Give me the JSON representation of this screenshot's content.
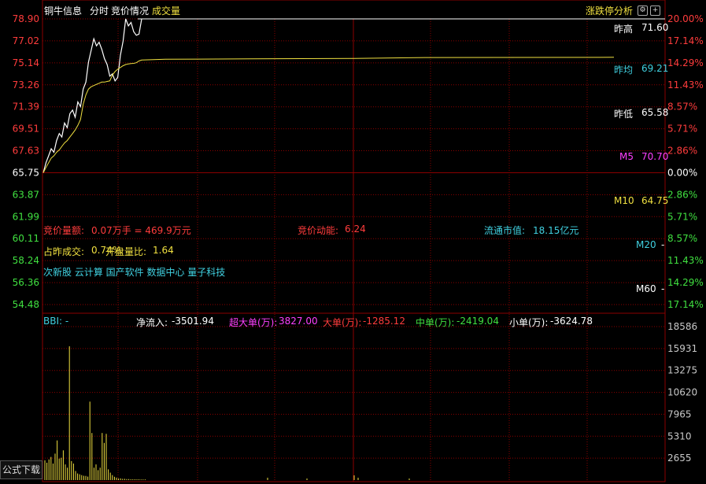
{
  "header": {
    "stock_name": "铜牛信息",
    "tab_fenshi": "分时",
    "tab_jingjia": "竞价情况",
    "tab_volume": "成交量",
    "analysis_btn": "涨跌停分析",
    "settings_icon": "gear-icon",
    "expand_icon": "plus-icon"
  },
  "price_axis": {
    "left_ticks": [
      "78.90",
      "77.02",
      "75.14",
      "73.26",
      "71.39",
      "69.51",
      "67.63",
      "65.75",
      "63.87",
      "61.99",
      "60.11",
      "58.24",
      "56.36",
      "54.48"
    ],
    "right_ticks": [
      "20.00%",
      "17.14%",
      "14.29%",
      "11.43%",
      "8.57%",
      "5.71%",
      "2.86%",
      "0.00%",
      "2.86%",
      "5.71%",
      "8.57%",
      "11.43%",
      "14.29%",
      "17.14%"
    ],
    "base_price": 65.75
  },
  "overlay_right": {
    "zuogao_label": "昨高",
    "zuogao_value": "71.60",
    "zuojun_label": "昨均",
    "zuojun_value": "69.21",
    "zuodi_label": "昨低",
    "zuodi_value": "65.58",
    "m5_label": "M5",
    "m5_value": "70.70",
    "m10_label": "M10",
    "m10_value": "64.75",
    "m20_label": "M20",
    "m20_value": "-",
    "m60_label": "M60",
    "m60_value": "-"
  },
  "auction_info": {
    "amount_label": "竞价量额:",
    "amount_value": "0.07万手 = 469.9万元",
    "momentum_label": "竞价动能:",
    "momentum_value": "6.24",
    "mktcap_label": "流通市值:",
    "mktcap_value": "18.15亿元",
    "prev_ratio_label": "占昨成交:",
    "prev_ratio_value": "0.74%",
    "open_ratio_label": "开盘量比:",
    "open_ratio_value": "1.64",
    "concepts": "次新股 云计算 国产软件 数据中心 量子科技"
  },
  "flow_bar": {
    "bbi": "BBI: -",
    "net_label": "净流入:",
    "net_value": "-3501.94",
    "super_label": "超大单(万):",
    "super_value": "3827.00",
    "big_label": "大单(万):",
    "big_value": "-1285.12",
    "mid_label": "中单(万):",
    "mid_value": "-2419.04",
    "small_label": "小单(万):",
    "small_value": "-3624.78"
  },
  "volume_axis": {
    "ticks": [
      "18586",
      "15931",
      "13275",
      "10620",
      "7965",
      "5310",
      "2655"
    ],
    "max": 18586
  },
  "download_btn": "公式下载",
  "colors": {
    "price_line": "#ffffff",
    "avg_line": "#f0e040",
    "grid": "#8b0000",
    "up": "#ff3c3c",
    "down": "#40e040",
    "volume": "#f0e040"
  },
  "chart_data": {
    "type": "line",
    "series": [
      {
        "values": [
          65.75,
          66.6,
          67.2,
          67.8,
          67.5,
          68.5,
          69.1,
          68.8,
          70.0,
          69.6,
          70.8,
          71.1,
          70.5,
          71.8,
          71.4,
          72.9,
          73.5,
          75.2,
          76.2,
          77.2,
          76.6,
          76.9,
          76.3,
          75.5,
          75.0,
          74.0,
          74.2,
          73.6,
          73.9,
          75.8,
          77.0,
          78.9,
          78.3,
          78.6,
          77.8,
          77.5,
          77.6,
          78.9
        ]
      },
      {
        "values": [
          65.75,
          66.2,
          66.6,
          67.0,
          67.2,
          67.5,
          67.7,
          68.0,
          68.3,
          68.5,
          68.8,
          69.1,
          69.4,
          69.8,
          70.3,
          71.6,
          72.4,
          72.9,
          73.1,
          73.2,
          73.3,
          73.4,
          73.5,
          73.5,
          73.55,
          73.6,
          74.1,
          74.4,
          74.6,
          74.75,
          74.9,
          75.0,
          75.05,
          75.08,
          75.1,
          75.15,
          75.3,
          75.38
        ]
      }
    ],
    "volumes": [
      2400,
      2100,
      2500,
      2800,
      2000,
      3200,
      4800,
      2600,
      2700,
      3600,
      1900,
      1500,
      16200,
      2300,
      2000,
      1100,
      800,
      700,
      600,
      520,
      500,
      420,
      9500,
      5700,
      1500,
      1900,
      1200,
      1500,
      5700,
      4500,
      5600,
      1300,
      900,
      600,
      400,
      300,
      200,
      200,
      150,
      150,
      120,
      120,
      100,
      100,
      100,
      90,
      90,
      80,
      80,
      80
    ]
  }
}
